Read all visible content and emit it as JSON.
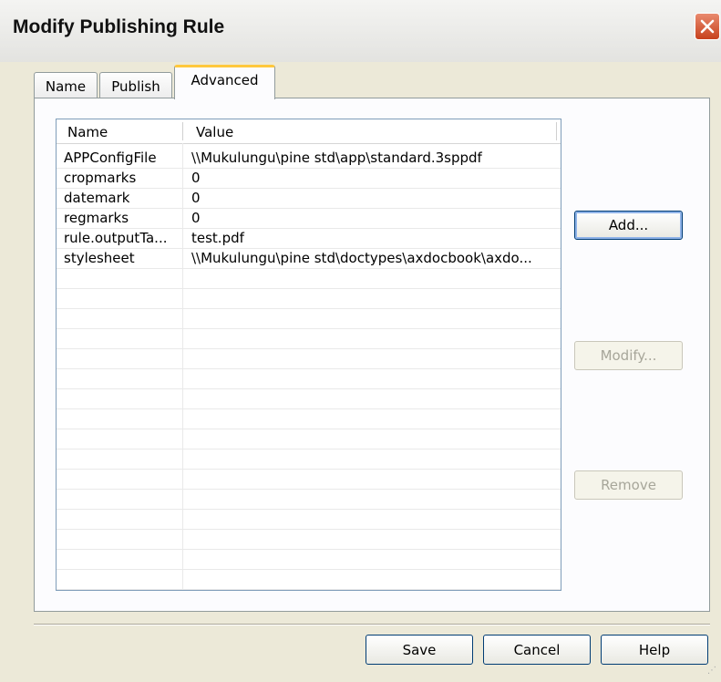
{
  "window": {
    "title": "Modify Publishing Rule"
  },
  "tabs": [
    {
      "label": "Name"
    },
    {
      "label": "Publish"
    },
    {
      "label": "Advanced"
    }
  ],
  "table": {
    "columns": [
      "Name",
      "Value"
    ],
    "rows": [
      {
        "name": "APPConfigFile",
        "value": "\\\\Mukulungu\\pine std\\app\\standard.3sppdf"
      },
      {
        "name": "cropmarks",
        "value": "0"
      },
      {
        "name": "datemark",
        "value": "0"
      },
      {
        "name": "regmarks",
        "value": "0"
      },
      {
        "name": "rule.outputTa...",
        "value": "test.pdf"
      },
      {
        "name": "stylesheet",
        "value": "\\\\Mukulungu\\pine std\\doctypes\\axdocbook\\axdo..."
      }
    ]
  },
  "side_buttons": {
    "add": "Add...",
    "modify": "Modify...",
    "remove": "Remove"
  },
  "footer_buttons": {
    "save": "Save",
    "cancel": "Cancel",
    "help": "Help"
  },
  "colors": {
    "tab_highlight": "#ffc83c",
    "close_button": "#c7411d",
    "dialog_bg": "#ece9d8",
    "list_border": "#7f9db9"
  }
}
